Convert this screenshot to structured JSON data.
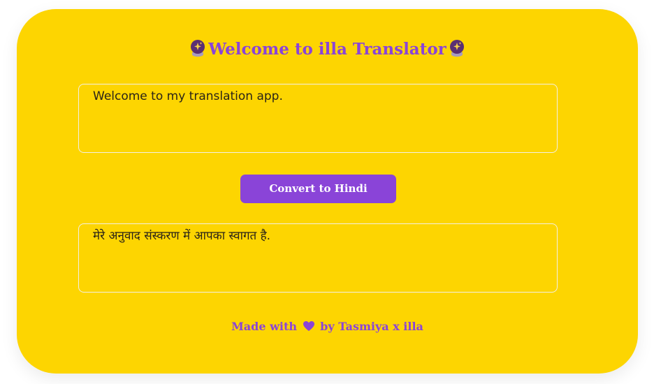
{
  "header": {
    "icon_left": "crystal-ball-icon",
    "title": "Welcome to illa Translator",
    "icon_right": "crystal-ball-icon"
  },
  "input": {
    "value": "Welcome to my translation app."
  },
  "convert_button": {
    "label": "Convert to Hindi"
  },
  "output": {
    "value": "मेरे अनुवाद संस्करण में आपका स्वागत है."
  },
  "footer": {
    "prefix": "Made with",
    "icon": "heart-icon",
    "suffix": "by Tasmiya x illa"
  },
  "colors": {
    "background": "#fdd501",
    "accent": "#8a44d8",
    "text": "#2a2418"
  }
}
